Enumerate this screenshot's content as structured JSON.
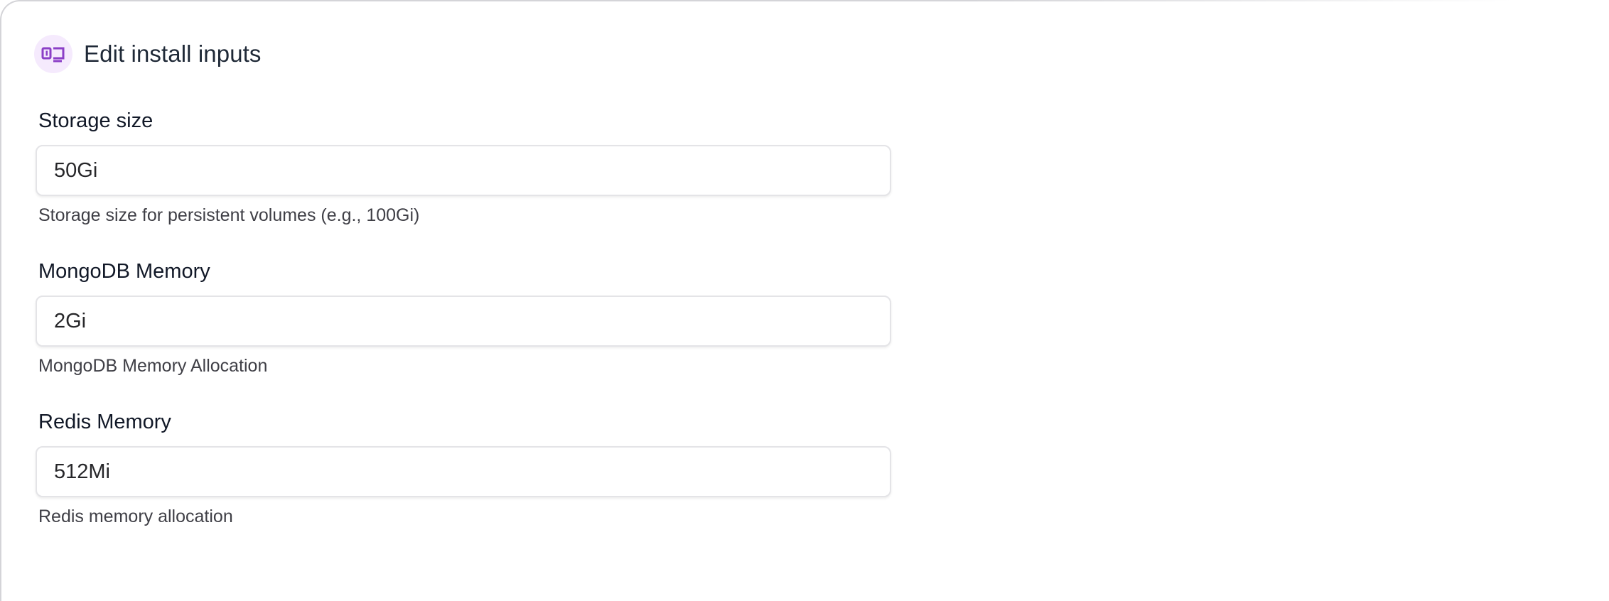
{
  "header": {
    "title": "Edit install inputs",
    "icon": "input-field-icon",
    "icon_color": "#8b3fc7",
    "icon_bg": "#f5eafd"
  },
  "fields": [
    {
      "label": "Storage size",
      "value": "50Gi",
      "help": "Storage size for persistent volumes (e.g., 100Gi)"
    },
    {
      "label": "MongoDB Memory",
      "value": "2Gi",
      "help": "MongoDB Memory Allocation"
    },
    {
      "label": "Redis Memory",
      "value": "512Mi",
      "help": "Redis memory allocation"
    }
  ]
}
